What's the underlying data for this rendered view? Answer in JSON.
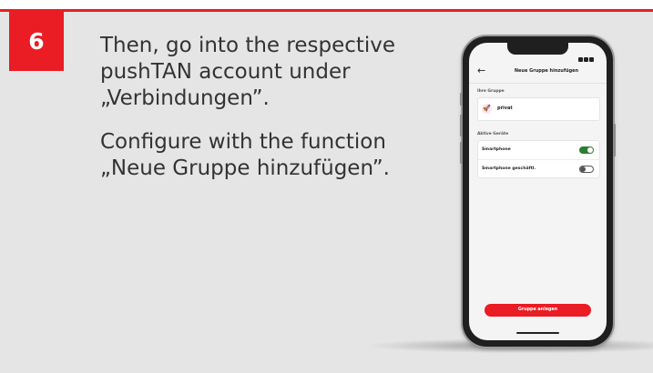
{
  "step": {
    "number": "6"
  },
  "instructions": {
    "paragraph1": "Then, go into the respective pushTAN account under „Verbindungen”.",
    "paragraph2": "Configure with the function „Neue Gruppe hinzufügen”."
  },
  "colors": {
    "accent": "#ea1c24",
    "card_bg": "#e5e5e5",
    "toggle_on": "#2e7d32"
  },
  "phone_app": {
    "back_icon": "arrow-left-icon",
    "title": "Neue Gruppe hinzufügen",
    "group_section_label": "Ihre Gruppe",
    "group": {
      "icon": "rocket-icon",
      "name": "privat"
    },
    "devices_section_label": "Aktive Geräte",
    "devices": [
      {
        "name": "Smartphone",
        "active": true
      },
      {
        "name": "Smartphone geschäftl.",
        "active": false
      }
    ],
    "primary_button": "Gruppe anlegen"
  }
}
